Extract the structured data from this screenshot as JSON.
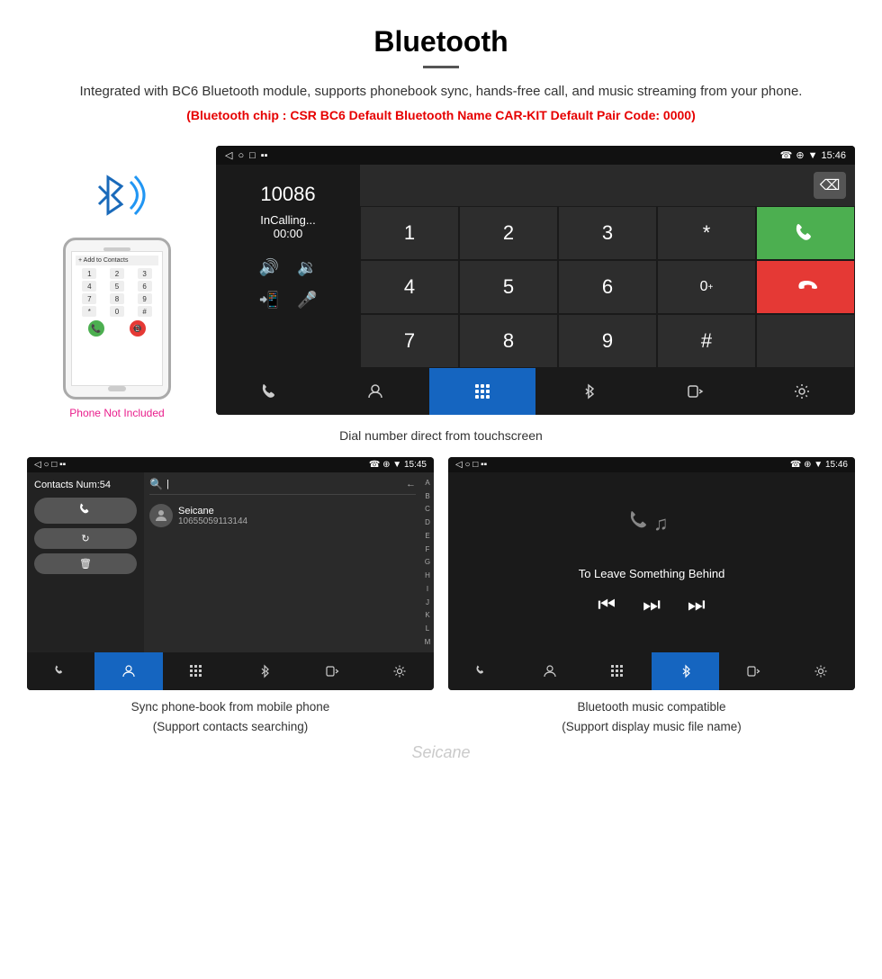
{
  "header": {
    "title": "Bluetooth",
    "description": "Integrated with BC6 Bluetooth module, supports phonebook sync, hands-free call, and music streaming from your phone.",
    "specs": "(Bluetooth chip : CSR BC6    Default Bluetooth Name CAR-KIT    Default Pair Code: 0000)"
  },
  "phone_side": {
    "not_included": "Phone Not Included"
  },
  "dial_screen": {
    "status_bar": {
      "back": "◁",
      "circle": "○",
      "square": "□",
      "icons_right": "☎ ⊕ ▼ 15:46"
    },
    "number": "10086",
    "calling_status": "InCalling...",
    "call_time": "00:00",
    "keys": [
      "1",
      "2",
      "3",
      "*",
      "",
      "4",
      "5",
      "6",
      "0+",
      "",
      "7",
      "8",
      "9",
      "#",
      ""
    ],
    "caption": "Dial number direct from touchscreen"
  },
  "contacts_screen": {
    "status_bar": "☎ ⊕ ▼ 15:45",
    "contacts_num": "Contacts Num:54",
    "contact_name": "Seicane",
    "contact_number": "10655059113144",
    "search_placeholder": "Search",
    "alpha_letters": [
      "A",
      "B",
      "C",
      "D",
      "E",
      "F",
      "G",
      "H",
      "I",
      "J",
      "K",
      "L",
      "M"
    ]
  },
  "music_screen": {
    "status_bar": "☎ ⊕ ▼ 15:46",
    "song_title": "To Leave Something Behind"
  },
  "bottom_captions": {
    "left": "Sync phone-book from mobile phone\n(Support contacts searching)",
    "right": "Bluetooth music compatible\n(Support display music file name)"
  },
  "watermark": "Seicane"
}
